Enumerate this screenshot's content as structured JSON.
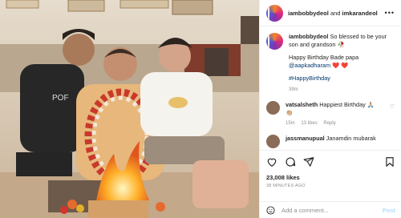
{
  "post": {
    "photo_description_icon": "family-birthday-photo"
  },
  "header": {
    "author": "iambobbydeol",
    "joiner": "and",
    "coauthor": "imkarandeol",
    "more": "•••"
  },
  "caption": {
    "author": "iambobbydeol",
    "line1": "So blessed to be your son and grandson 🥀",
    "line2": "Happy Birthday Bade papa",
    "mention": "@aapkadharam",
    "hearts": "❤️ ❤️",
    "hashtag": "#HappyBirthday",
    "time": "39m"
  },
  "comments": [
    {
      "author": "vatsalsheth",
      "text": "Happiest Birthday 🙏🏼",
      "emoji2": "👏🏼",
      "time": "15m",
      "likes": "13 likes",
      "reply": "Reply"
    },
    {
      "author": "jassmanupual",
      "text": "Janamdin mubarak",
      "time": "",
      "likes": "",
      "reply": ""
    }
  ],
  "engagement": {
    "likes": "23,008 likes",
    "posted": "38 MINUTES AGO"
  },
  "composer": {
    "placeholder": "Add a comment...",
    "post_label": "Post"
  }
}
